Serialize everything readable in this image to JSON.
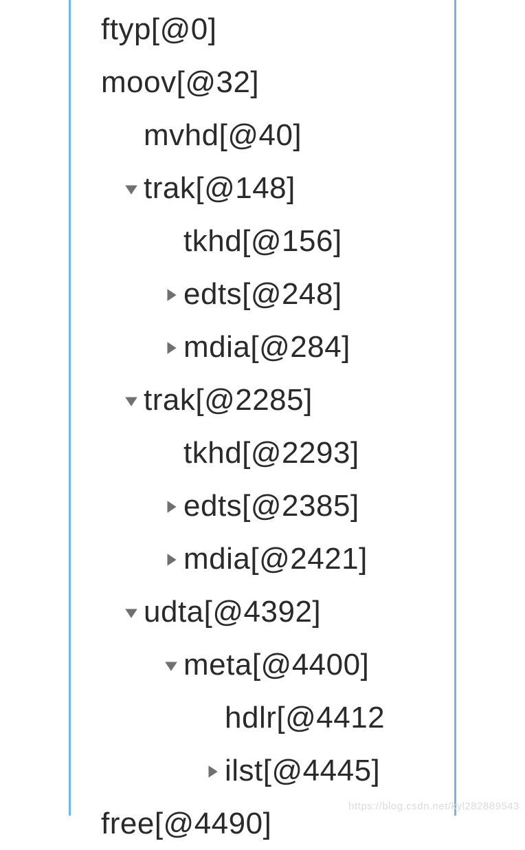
{
  "tree": {
    "rows": [
      {
        "indent": 0,
        "arrow": "none",
        "label": "ftyp[@0]",
        "name": "node-ftyp"
      },
      {
        "indent": 0,
        "arrow": "none",
        "label": "moov[@32]",
        "name": "node-moov"
      },
      {
        "indent": 1,
        "arrow": "none",
        "label": "mvhd[@40]",
        "name": "node-mvhd"
      },
      {
        "indent": 1,
        "arrow": "down",
        "label": "trak[@148]",
        "name": "node-trak-148"
      },
      {
        "indent": 2,
        "arrow": "none",
        "label": "tkhd[@156]",
        "name": "node-tkhd-156"
      },
      {
        "indent": 2,
        "arrow": "right",
        "label": "edts[@248]",
        "name": "node-edts-248"
      },
      {
        "indent": 2,
        "arrow": "right",
        "label": "mdia[@284]",
        "name": "node-mdia-284"
      },
      {
        "indent": 1,
        "arrow": "down",
        "label": "trak[@2285]",
        "name": "node-trak-2285"
      },
      {
        "indent": 2,
        "arrow": "none",
        "label": "tkhd[@2293]",
        "name": "node-tkhd-2293"
      },
      {
        "indent": 2,
        "arrow": "right",
        "label": "edts[@2385]",
        "name": "node-edts-2385"
      },
      {
        "indent": 2,
        "arrow": "right",
        "label": "mdia[@2421]",
        "name": "node-mdia-2421"
      },
      {
        "indent": 1,
        "arrow": "down",
        "label": "udta[@4392]",
        "name": "node-udta"
      },
      {
        "indent": 2,
        "arrow": "down",
        "label": "meta[@4400]",
        "name": "node-meta"
      },
      {
        "indent": 3,
        "arrow": "none",
        "label": "hdlr[@4412",
        "name": "node-hdlr"
      },
      {
        "indent": 3,
        "arrow": "right",
        "label": "ilst[@4445]",
        "name": "node-ilst"
      },
      {
        "indent": 0,
        "arrow": "none",
        "label": "free[@4490]",
        "name": "node-free"
      }
    ]
  },
  "watermark": "https://blog.csdn.net/kyl282889543"
}
